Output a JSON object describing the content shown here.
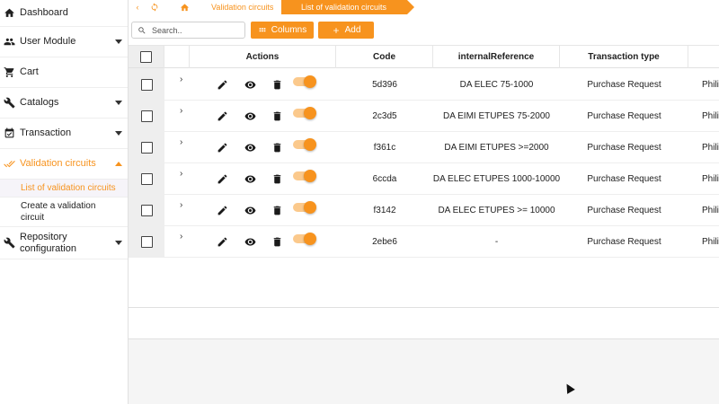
{
  "sidebar": {
    "items": [
      {
        "label": "Dashboard",
        "icon": "home-icon",
        "caret": false
      },
      {
        "label": "User Module",
        "icon": "people-icon",
        "caret": true
      },
      {
        "label": "Cart",
        "icon": "cart-icon",
        "caret": false
      },
      {
        "label": "Catalogs",
        "icon": "wrench-icon",
        "caret": true
      },
      {
        "label": "Transaction",
        "icon": "calendar-check-icon",
        "caret": true
      },
      {
        "label": "Validation circuits",
        "icon": "double-check-icon",
        "caret": true,
        "active": true
      },
      {
        "label": "Repository configuration",
        "icon": "wrench-icon",
        "caret": true
      }
    ],
    "subitems": [
      {
        "label": "List of validation circuits",
        "current": true
      },
      {
        "label": "Create a validation circuit",
        "current": false
      }
    ]
  },
  "breadcrumb": {
    "parent": "Validation circuits",
    "current": "List of validation circuits"
  },
  "toolbar": {
    "search_placeholder": "Search..",
    "columns_label": "Columns",
    "add_label": "Add"
  },
  "table": {
    "headers": {
      "actions": "Actions",
      "code": "Code",
      "internal_reference": "internalReference",
      "transaction_type": "Transaction type"
    },
    "rows": [
      {
        "code": "5d396",
        "internal_reference": "DA ELEC 75-1000",
        "transaction_type": "Purchase Request",
        "extra": "Phili"
      },
      {
        "code": "2c3d5",
        "internal_reference": "DA EIMI ETUPES 75-2000",
        "transaction_type": "Purchase Request",
        "extra": "Phili"
      },
      {
        "code": "f361c",
        "internal_reference": "DA EIMI ETUPES >=2000",
        "transaction_type": "Purchase Request",
        "extra": "Phili"
      },
      {
        "code": "6ccda",
        "internal_reference": "DA ELEC ETUPES 1000-10000",
        "transaction_type": "Purchase Request",
        "extra": "Phili"
      },
      {
        "code": "f3142",
        "internal_reference": "DA ELEC ETUPES >= 10000",
        "transaction_type": "Purchase Request",
        "extra": "Phili"
      },
      {
        "code": "2ebe6",
        "internal_reference": "-",
        "transaction_type": "Purchase Request",
        "extra": "Phili"
      }
    ]
  },
  "colors": {
    "accent": "#f7931e",
    "accent_light": "#fbc98c",
    "text": "#212121"
  }
}
